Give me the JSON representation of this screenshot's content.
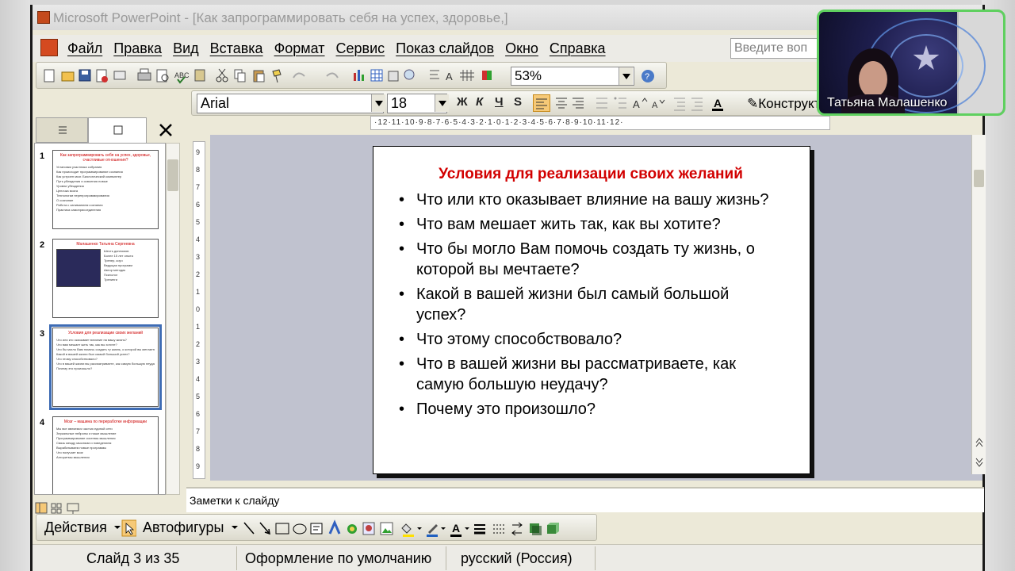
{
  "window": {
    "title": "Microsoft PowerPoint - [Как запрограммировать себя на успех, здоровье,]"
  },
  "menu": {
    "items": [
      "Файл",
      "Правка",
      "Вид",
      "Вставка",
      "Формат",
      "Сервис",
      "Показ слайдов",
      "Окно",
      "Справка"
    ],
    "help_placeholder": "Введите воп"
  },
  "standard_toolbar": {
    "zoom": "53%"
  },
  "formatting_toolbar": {
    "font": "Arial",
    "size": "18",
    "bold": "Ж",
    "italic": "К",
    "underline": "Ч",
    "shadow": "S",
    "design": "Конструктор"
  },
  "ruler": {
    "horizontal": "·12·11·10·9·8·7·6·5·4·3·2·1·0·1·2·3·4·5·6·7·8·9·10·11·12·",
    "vertical": [
      "9",
      "8",
      "7",
      "6",
      "5",
      "4",
      "3",
      "2",
      "1",
      "0",
      "1",
      "2",
      "3",
      "4",
      "5",
      "6",
      "7",
      "8",
      "9"
    ]
  },
  "thumbnails": [
    {
      "num": "1",
      "title": "Как запрограммировать себя на успех, здоровье, счастливые отношения?",
      "lines": [
        "Установки участника собрания",
        "Как происходит программирование сознания",
        "Как устроен мозг. Биологический компьютер",
        "Путь убеждения и освоения новые",
        "Уровни убеждения",
        "Цепочка мозга",
        "Технологии перепрограммирования",
        "О сознание",
        "Работа с заниманием сознания",
        "Практика самоприсоединения"
      ]
    },
    {
      "num": "2",
      "title": "Малашенко Татьяна Сергеевна",
      "lines": [
        "Шесть дипломов",
        "Более 15 лет опыта",
        "Тренер, коуч",
        "Ведущая программ",
        "Автор методик",
        "Психолог",
        "Тренинги"
      ]
    },
    {
      "num": "3",
      "title": "Условия для реализации своих желаний",
      "lines": [
        "Что или кто оказывает влияние на вашу жизнь?",
        "Что вам мешает жить так, как вы хотите?",
        "Что бы могло Вам помочь создать ту жизнь, о которой вы мечтаете?",
        "Какой в вашей жизни был самый большой успех?",
        "Что этому способствовало?",
        "Что в вашей жизни вы рассматриваете, как самую большую неудачу?",
        "Почему это произошло?"
      ]
    },
    {
      "num": "4",
      "title": "Мозг – машина по переработке информации",
      "lines": [
        "Мы все являемся частью единой сети",
        "Зеркальные нейроны и наше мышление",
        "Программирование системы мышления",
        "Связь между мыслями и поведением",
        "Вырабатываем новые программы",
        "Что получает мозг",
        "Алгоритмы мышления"
      ]
    }
  ],
  "slide": {
    "title": "Условия для реализации своих желаний",
    "bullets": [
      "Что или кто оказывает влияние на вашу жизнь?",
      "Что вам мешает жить так, как вы хотите?",
      "Что бы могло Вам помочь создать ту жизнь, о которой вы мечтаете?",
      "Какой в вашей жизни был самый большой успех?",
      "Что этому способствовало?",
      "Что в вашей жизни вы рассматриваете, как самую большую неудачу?",
      "Почему это произошло?"
    ]
  },
  "notes": {
    "placeholder": "Заметки к слайду"
  },
  "drawing_toolbar": {
    "actions": "Действия",
    "autoshapes": "Автофигуры"
  },
  "status": {
    "slide": "Слайд 3 из 35",
    "design": "Оформление по умолчанию",
    "language": "русский (Россия)"
  },
  "webcam": {
    "name": "Татьяна Малашенко"
  },
  "colors": {
    "slide_title": "#d20000",
    "canvas_bg": "#c0c2cf",
    "selected_thumb": "#3e6cb4",
    "webcam_border": "#5fd05f"
  }
}
